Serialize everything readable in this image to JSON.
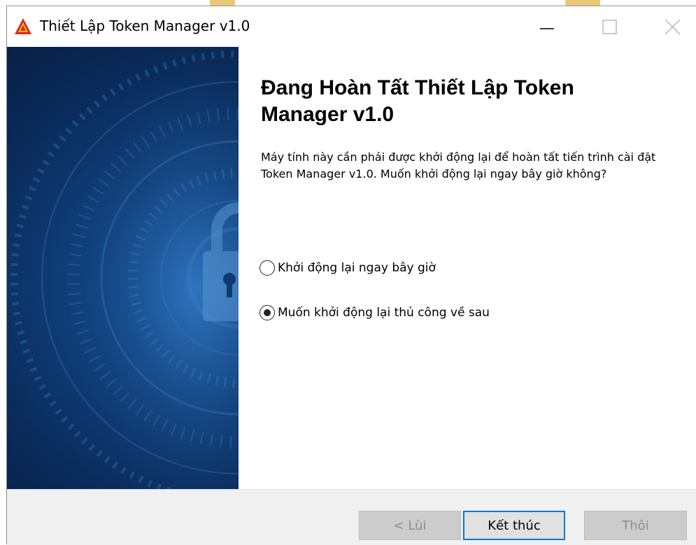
{
  "window": {
    "title": "Thiết Lập Token Manager v1.0",
    "icon": "app-logo-icon",
    "controls": {
      "minimize": "minimize-icon",
      "maximize": "maximize-icon",
      "close": "close-icon"
    }
  },
  "banner": {
    "image": "padlock-security-banner"
  },
  "main": {
    "heading": "Đang Hoàn Tất Thiết Lập Token Manager v1.0",
    "description": "Máy tính này cần phải được khởi động lại để hoàn tất tiến trình cài đặt Token Manager v1.0. Muốn khởi động lại ngay bây giờ không?",
    "options": [
      {
        "label": "Khởi động lại ngay bây giờ",
        "selected": false
      },
      {
        "label": "Muốn khởi động lại thủ công về sau",
        "selected": true
      }
    ]
  },
  "footer": {
    "back_label": "< Lùi",
    "back_enabled": false,
    "finish_label": "Kết thúc",
    "cancel_label": "Thôi",
    "cancel_enabled": false
  },
  "colors": {
    "accent": "#0078d7",
    "banner": "#11427e",
    "footer_bg": "#f0f0f0",
    "disabled_bg": "#cccccc",
    "disabled_text": "#8d8d8d"
  }
}
